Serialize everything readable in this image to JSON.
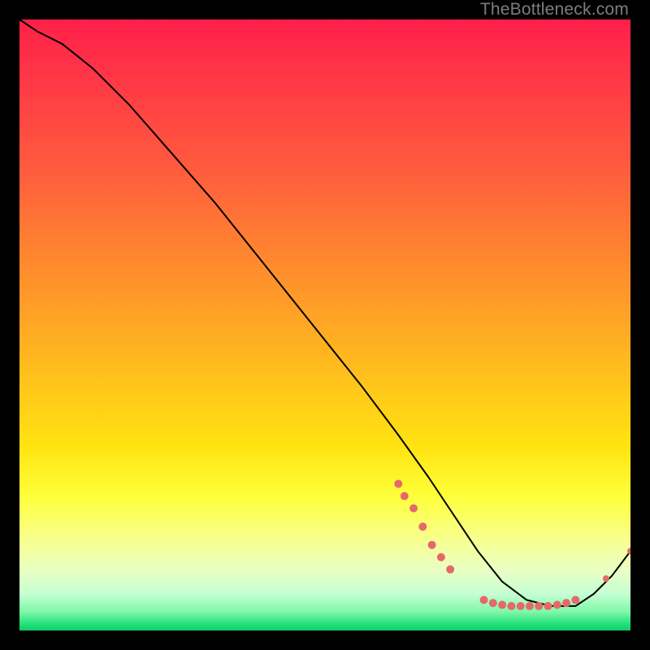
{
  "watermark": "TheBottleneck.com",
  "chart_data": {
    "type": "line",
    "title": "",
    "xlabel": "",
    "ylabel": "",
    "xlim": [
      0,
      100
    ],
    "ylim": [
      0,
      100
    ],
    "grid": false,
    "background": "red-yellow-green vertical gradient (bottleneck heatmap)",
    "series": [
      {
        "name": "bottleneck-curve",
        "color": "#000000",
        "stroke_width": 2,
        "x": [
          0,
          3,
          7,
          12,
          18,
          25,
          32,
          40,
          48,
          56,
          62,
          67,
          71,
          75,
          79,
          83,
          87,
          91,
          94,
          97,
          100
        ],
        "y": [
          100,
          98,
          96,
          92,
          86,
          78,
          70,
          60,
          50,
          40,
          32,
          25,
          19,
          13,
          8,
          5,
          4,
          4,
          6,
          9,
          13
        ]
      }
    ],
    "markers": [
      {
        "name": "curve-dots-descent",
        "color": "#e46a6a",
        "radius": 5,
        "points": [
          {
            "x": 62,
            "y": 24
          },
          {
            "x": 63,
            "y": 22
          },
          {
            "x": 64.5,
            "y": 20
          },
          {
            "x": 66,
            "y": 17
          },
          {
            "x": 67.5,
            "y": 14
          },
          {
            "x": 69,
            "y": 12
          },
          {
            "x": 70.5,
            "y": 10
          }
        ]
      },
      {
        "name": "curve-dots-valley",
        "color": "#e46a6a",
        "radius": 5,
        "points": [
          {
            "x": 76,
            "y": 5
          },
          {
            "x": 77.5,
            "y": 4.5
          },
          {
            "x": 79,
            "y": 4.2
          },
          {
            "x": 80.5,
            "y": 4
          },
          {
            "x": 82,
            "y": 4
          },
          {
            "x": 83.5,
            "y": 4
          },
          {
            "x": 85,
            "y": 4
          },
          {
            "x": 86.5,
            "y": 4
          },
          {
            "x": 88,
            "y": 4.2
          },
          {
            "x": 89.5,
            "y": 4.5
          },
          {
            "x": 91,
            "y": 5
          }
        ]
      },
      {
        "name": "curve-dots-rise",
        "color": "#e46a6a",
        "radius": 4,
        "points": [
          {
            "x": 96,
            "y": 8.5
          },
          {
            "x": 100,
            "y": 13
          }
        ]
      }
    ]
  }
}
